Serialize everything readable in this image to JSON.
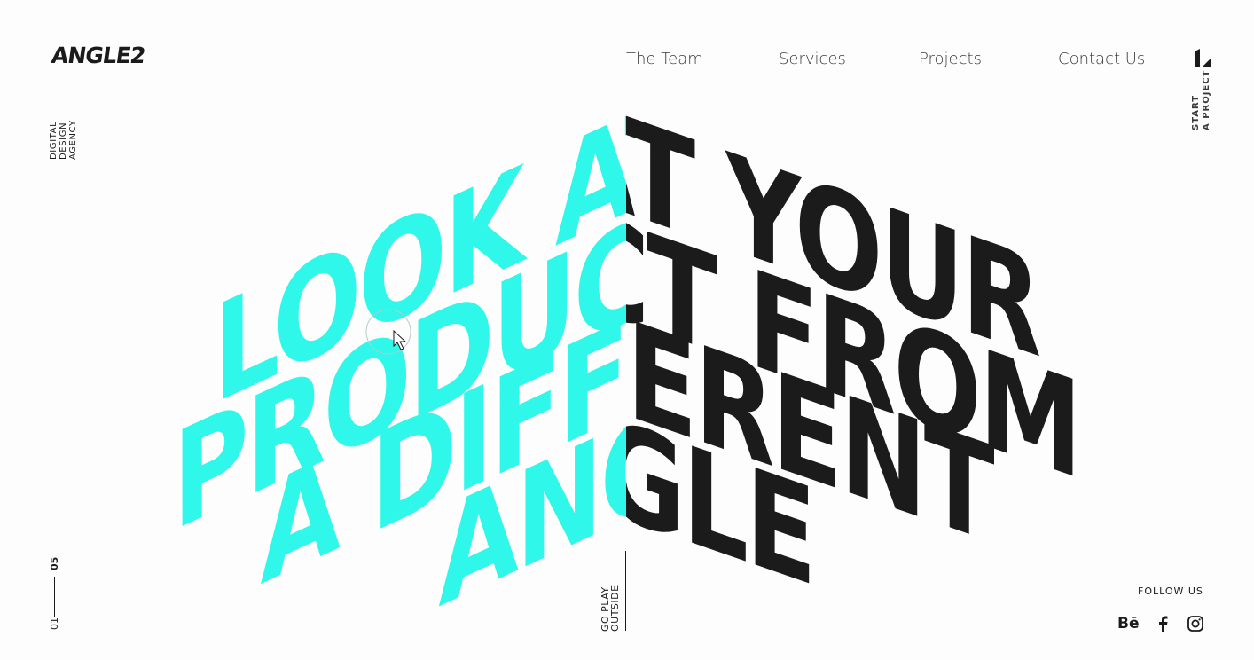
{
  "brand": {
    "logo": "ANGLE2",
    "tagline": [
      "DIGITAL",
      "DESIGN",
      "AGENCY"
    ]
  },
  "nav": {
    "items": [
      {
        "label": "The Team"
      },
      {
        "label": "Services"
      },
      {
        "label": "Projects"
      },
      {
        "label": "Contact Us"
      }
    ]
  },
  "cta": {
    "lines": [
      "START",
      "A PROJECT"
    ]
  },
  "hero": {
    "lines": [
      "LOOK AT YOUR",
      "PRODUCT FROM",
      "A DIFFERENT",
      "ANGLE"
    ],
    "colors": {
      "left": "#2ff7ea",
      "right": "#1b1b1b"
    }
  },
  "slider": {
    "current": "05",
    "total": "01"
  },
  "play": {
    "lines": [
      "GO PLAY",
      "OUTSIDE"
    ]
  },
  "social": {
    "title": "FOLLOW US",
    "behance": "Bē",
    "icons": [
      "behance-icon",
      "facebook-icon",
      "instagram-icon"
    ]
  }
}
